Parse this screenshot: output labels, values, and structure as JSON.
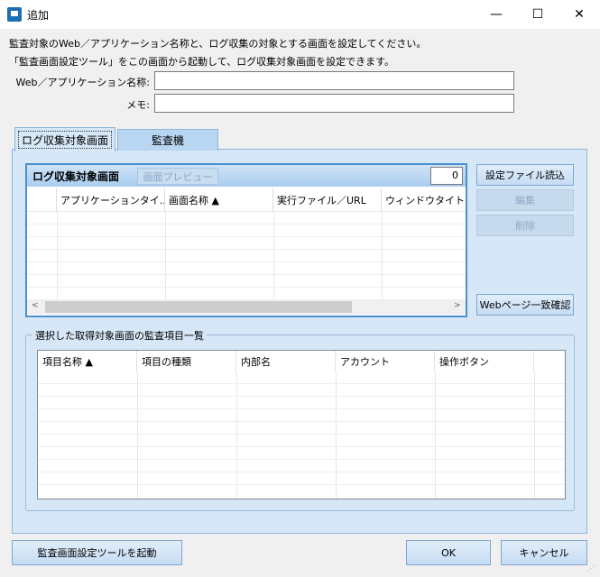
{
  "window": {
    "title": "追加",
    "controls": {
      "minimize": "—",
      "maximize": "☐",
      "close": "✕"
    }
  },
  "description": {
    "line1": "監査対象のWeb／アプリケーション名称と、ログ収集の対象とする画面を設定してください。",
    "line2": "「監査画面設定ツール」をこの画面から起動して、ログ収集対象画面を設定できます。"
  },
  "form": {
    "app_name_label": "Web／アプリケーション名称:",
    "app_name_value": "",
    "memo_label": "メモ:",
    "memo_value": ""
  },
  "tabs": [
    {
      "label": "ログ収集対象画面",
      "active": true
    },
    {
      "label": "監査機",
      "active": false
    }
  ],
  "screen_list": {
    "title": "ログ収集対象画面",
    "preview_button": "画面プレビュー",
    "count": "0",
    "columns": [
      "アプリケーションタイ...",
      "画面名称 ▲",
      "実行ファイル／URL",
      "ウィンドウタイトル"
    ],
    "scroll_left": "<",
    "scroll_right": ">"
  },
  "side_buttons": {
    "load_config": "設定ファイル読込",
    "edit": "編集",
    "delete": "削除",
    "web_page_match": "Webページ一致確認"
  },
  "items_group": {
    "legend": "選択した取得対象画面の監査項目一覧",
    "columns": [
      "項目名称 ▲",
      "項目の種類",
      "内部名",
      "アカウント",
      "操作ボタン"
    ]
  },
  "bottom_buttons": {
    "launch_tool": "監査画面設定ツールを起動",
    "ok": "OK",
    "cancel": "キャンセル"
  },
  "icons": {
    "app": "app-window-icon",
    "sort_asc": "sort-ascending-icon",
    "resize": "resize-grip-icon"
  },
  "colors": {
    "tab_panel": "#d6e7f7",
    "accent_border": "#4c8ed0",
    "button_gradient_top": "#e1eefb",
    "button_gradient_bottom": "#c6dcf3"
  }
}
